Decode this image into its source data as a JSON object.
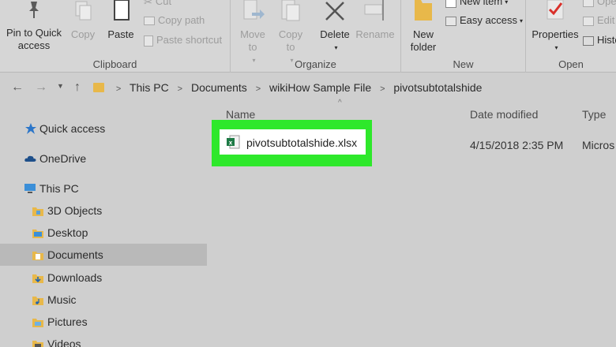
{
  "ribbon": {
    "clipboard": {
      "label": "Clipboard",
      "pin_label": "Pin to Quick access",
      "copy_label": "Copy",
      "paste_label": "Paste",
      "cut_label": "Cut",
      "copy_path_label": "Copy path",
      "paste_shortcut_label": "Paste shortcut"
    },
    "organize": {
      "label": "Organize",
      "move_to_label": "Move to",
      "copy_to_label": "Copy to",
      "delete_label": "Delete",
      "rename_label": "Rename"
    },
    "new": {
      "label": "New",
      "new_folder_label": "New folder",
      "new_item_label": "New item",
      "easy_access_label": "Easy access"
    },
    "open": {
      "label": "Open",
      "properties_label": "Properties",
      "open_label": "Open",
      "edit_label": "Edit",
      "history_label": "History"
    }
  },
  "address": {
    "crumbs": [
      "This PC",
      "Documents",
      "wikiHow Sample File",
      "pivotsubtotalshide"
    ]
  },
  "nav": {
    "items": [
      {
        "label": "Quick access",
        "icon": "star-icon"
      },
      {
        "label": "OneDrive",
        "icon": "cloud-icon"
      },
      {
        "label": "This PC",
        "icon": "computer-icon"
      },
      {
        "label": "3D Objects",
        "icon": "3d-objects-icon"
      },
      {
        "label": "Desktop",
        "icon": "desktop-icon"
      },
      {
        "label": "Documents",
        "icon": "documents-icon"
      },
      {
        "label": "Downloads",
        "icon": "downloads-icon"
      },
      {
        "label": "Music",
        "icon": "music-icon"
      },
      {
        "label": "Pictures",
        "icon": "pictures-icon"
      },
      {
        "label": "Videos",
        "icon": "videos-icon"
      }
    ],
    "selected": "Documents"
  },
  "content": {
    "columns": {
      "name": "Name",
      "date": "Date modified",
      "type": "Type"
    },
    "file": {
      "name": "pivotsubtotalshide.xlsx",
      "date": "4/15/2018 2:35 PM",
      "type": "Micros"
    },
    "highlight_color": "#2ee82b"
  }
}
